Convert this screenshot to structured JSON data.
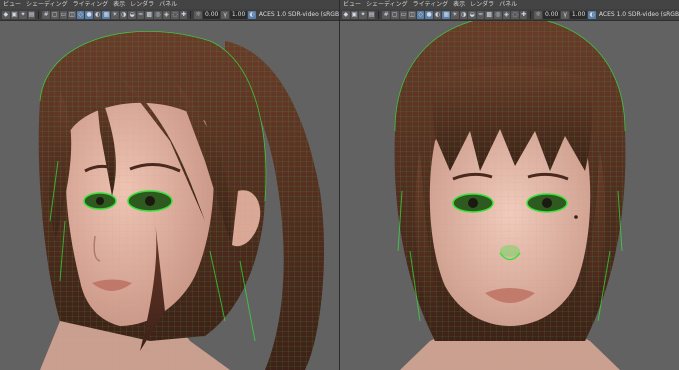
{
  "left_viewport": {
    "menu": [
      "ビュー",
      "シェーディング",
      "ライティング",
      "表示",
      "レンダラ",
      "パネル"
    ],
    "toolbar": {
      "exposure_value": "0.00",
      "gamma_value": "1.00",
      "color_space": "ACES 1.0 SDR-video (sRGB"
    }
  },
  "right_viewport": {
    "menu": [
      "ビュー",
      "シェーディング",
      "ライティング",
      "表示",
      "レンダラ",
      "パネル"
    ],
    "toolbar": {
      "exposure_value": "0.00",
      "gamma_value": "1.00",
      "color_space": "ACES 1.0 SDR-video (sRGB"
    }
  },
  "colors": {
    "viewport_bg": "#626262",
    "wire": "#37e23a",
    "hair": "#5a3124",
    "skin": "#e4b6a4"
  }
}
